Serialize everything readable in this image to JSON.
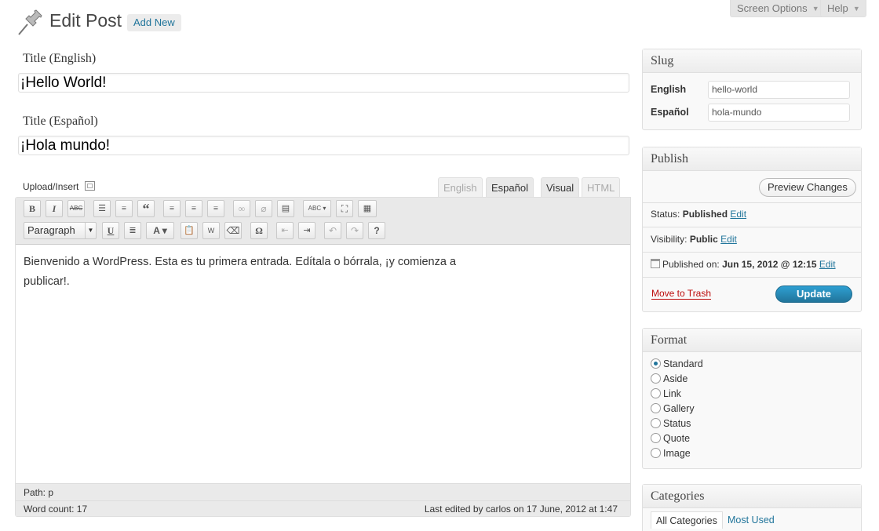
{
  "header": {
    "title": "Edit Post",
    "add_new": "Add New",
    "screen_options": "Screen Options",
    "help": "Help"
  },
  "titles": [
    {
      "label": "Title (English)",
      "value": "¡Hello World!"
    },
    {
      "label": "Title (Español)",
      "value": "¡Hola mundo!"
    }
  ],
  "editor": {
    "upload_insert": "Upload/Insert",
    "lang_tabs": [
      "English",
      "Español"
    ],
    "mode_tabs": [
      "Visual",
      "HTML"
    ],
    "format_select": "Paragraph",
    "content": "Bienvenido a WordPress. Esta es tu primera entrada. Edítala o bórrala, ¡y comienza a publicar!.",
    "path_label": "Path:",
    "path_value": "p",
    "word_count": "Word count: 17",
    "last_edited": "Last edited by carlos on 17 June, 2012 at 1:47"
  },
  "slug": {
    "title": "Slug",
    "rows": [
      {
        "label": "English",
        "value": "hello-world"
      },
      {
        "label": "Español",
        "value": "hola-mundo"
      }
    ]
  },
  "publish": {
    "title": "Publish",
    "preview": "Preview Changes",
    "status_label": "Status:",
    "status_value": "Published",
    "visibility_label": "Visibility:",
    "visibility_value": "Public",
    "published_label": "Published on:",
    "published_value": "Jun 15, 2012 @ 12:15",
    "edit": "Edit",
    "trash": "Move to Trash",
    "update": "Update"
  },
  "format": {
    "title": "Format",
    "options": [
      "Standard",
      "Aside",
      "Link",
      "Gallery",
      "Status",
      "Quote",
      "Image"
    ],
    "selected": "Standard"
  },
  "categories": {
    "title": "Categories",
    "tabs": [
      "All Categories",
      "Most Used"
    ]
  },
  "colors": {
    "link": "#21759b",
    "trash": "#bc0b0b",
    "update": "#21759b"
  }
}
